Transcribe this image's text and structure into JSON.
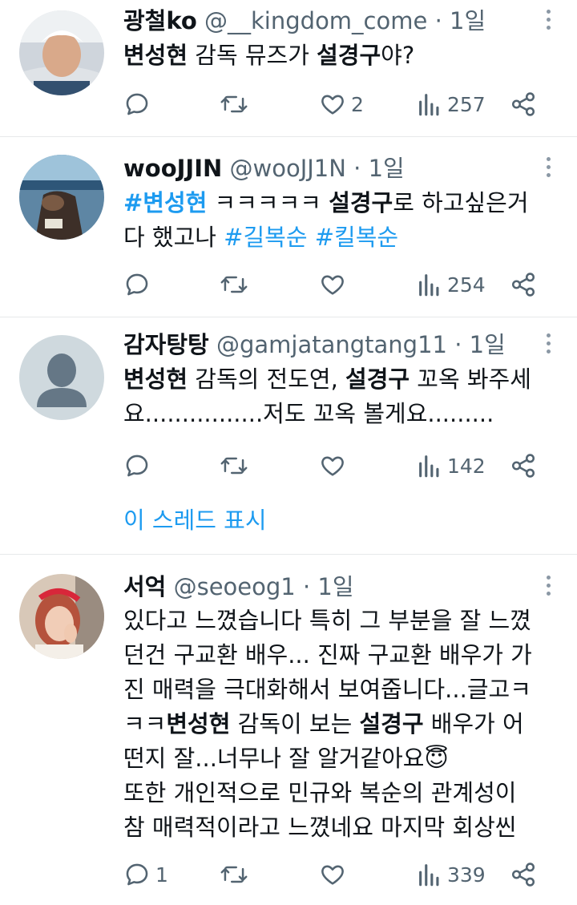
{
  "tweets": [
    {
      "name": "광철ko",
      "handle": "@__kingdom_come",
      "sep": "·",
      "time": "1일",
      "body": [
        {
          "bold": "변성현"
        },
        {
          "text": " 감독 뮤즈가 "
        },
        {
          "bold": "설경구"
        },
        {
          "text": "야?"
        }
      ],
      "counts": {
        "reply": "",
        "retweet": "",
        "like": "2",
        "views": "257"
      }
    },
    {
      "name": "wooJJIN",
      "handle": "@wooJJ1N",
      "sep": "·",
      "time": "1일",
      "body_line1": {
        "tag1": "#변성현",
        "text1": " ㅋㅋㅋㅋㅋ ",
        "bold1": "설경구",
        "text2": "로 하고싶은거"
      },
      "body_line2": {
        "text1": "다 했고나 ",
        "tag2": "#길복순",
        "text2": " ",
        "tag3": "#킬복순"
      },
      "counts": {
        "reply": "",
        "retweet": "",
        "like": "",
        "views": "254"
      }
    },
    {
      "name": "감자탕탕",
      "handle": "@gamjatangtang11",
      "sep": "·",
      "time": "1일",
      "body_line1": {
        "bold1": "변성현",
        "text1": " 감독의 전도연, ",
        "bold2": "설경구",
        "text2": " 꼬옥 봐주세"
      },
      "body_line2": {
        "text1": "요................저도 꼬옥 볼게요........."
      },
      "counts": {
        "reply": "",
        "retweet": "",
        "like": "",
        "views": "142"
      },
      "thread_link": "이 스레드 표시"
    },
    {
      "name": "서억",
      "handle": "@seoeog1",
      "sep": "·",
      "time": "1일",
      "lines": {
        "l1": "있다고 느꼈습니다 특히 그 부분을 잘 느꼈",
        "l2": "던건 구교환 배우... 진짜 구교환 배우가 가",
        "l3": "진 매력을 극대화해서 보여줍니다...글고ㅋ",
        "l4a": "ㅋㅋ",
        "l4b": "변성현",
        "l4c": " 감독이 보는 ",
        "l4d": "설경구",
        "l4e": " 배우가 어",
        "l5": "떤지 잘...너무나 잘 알거같아요😇",
        "l6": "또한 개인적으로 민규와 복순의 관계성이",
        "l7": "참 매력적이라고 느꼈네요 마지막 회상씬"
      },
      "counts": {
        "reply": "1",
        "retweet": "",
        "like": "",
        "views": "339"
      }
    }
  ],
  "icons": [
    "reply-icon",
    "retweet-icon",
    "like-icon",
    "views-icon",
    "share-icon",
    "more-icon"
  ],
  "colors": {
    "link": "#1d9bf0",
    "secondary": "#536471",
    "divider": "#e7e9ea"
  }
}
